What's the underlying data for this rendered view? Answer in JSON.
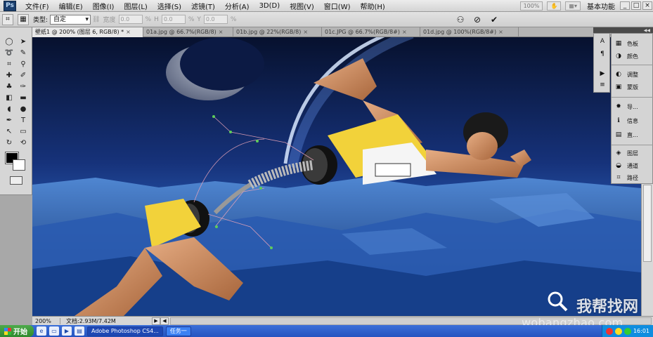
{
  "app": {
    "logo": "Ps",
    "workspace": "基本功能"
  },
  "menu": [
    "文件(F)",
    "编辑(E)",
    "图像(I)",
    "图层(L)",
    "选择(S)",
    "滤镜(T)",
    "分析(A)",
    "3D(D)",
    "视图(V)",
    "窗口(W)",
    "帮助(H)"
  ],
  "menu_right": {
    "zoom_box": "100%",
    "minimize": "_",
    "restore": "□",
    "close": "×"
  },
  "options": {
    "style_label": "类型:",
    "style_value": "自定",
    "width_label": "宽度",
    "width_value": "0.0",
    "h_label": "H",
    "h_value": "0.0",
    "y_label": "Y",
    "y_value": "0.0",
    "percent": "%"
  },
  "doc_tabs": [
    {
      "label": "壁纸1 @ 200% (图层 6, RGB/8) *",
      "active": true
    },
    {
      "label": "01a.jpg @ 66.7%(RGB/8)",
      "active": false
    },
    {
      "label": "01b.jpg @ 22%(RGB/8)",
      "active": false
    },
    {
      "label": "01c.JPG @ 66.7%(RGB/8#)",
      "active": false
    },
    {
      "label": "01d.jpg @ 100%(RGB/8#)",
      "active": false
    }
  ],
  "tab_close": "×",
  "status": {
    "zoom": "200%",
    "doc_size": "文档:2.93M/7.42M"
  },
  "panels": [
    {
      "glyph": "▦",
      "label": "色板"
    },
    {
      "glyph": "◑",
      "label": "颜色"
    },
    {
      "glyph": "◐",
      "label": "调整"
    },
    {
      "glyph": "▣",
      "label": "蒙版"
    },
    {
      "glyph": "✸",
      "label": "导..."
    },
    {
      "glyph": "ℹ",
      "label": "信息"
    },
    {
      "glyph": "▤",
      "label": "直..."
    },
    {
      "glyph": "◈",
      "label": "图层"
    },
    {
      "glyph": "◒",
      "label": "通道"
    },
    {
      "glyph": "⌗",
      "label": "路径"
    }
  ],
  "panel_icons": [
    "A",
    "¶",
    "▶",
    "≡"
  ],
  "watermark": {
    "name": "我帮找网",
    "url": "wobangzhao.com"
  },
  "taskbar": {
    "start": "开始",
    "tasks": [
      {
        "label": "Adobe Photoshop CS4...",
        "active": true
      },
      {
        "label": "任务一",
        "active": false
      }
    ],
    "time": "16:01"
  }
}
